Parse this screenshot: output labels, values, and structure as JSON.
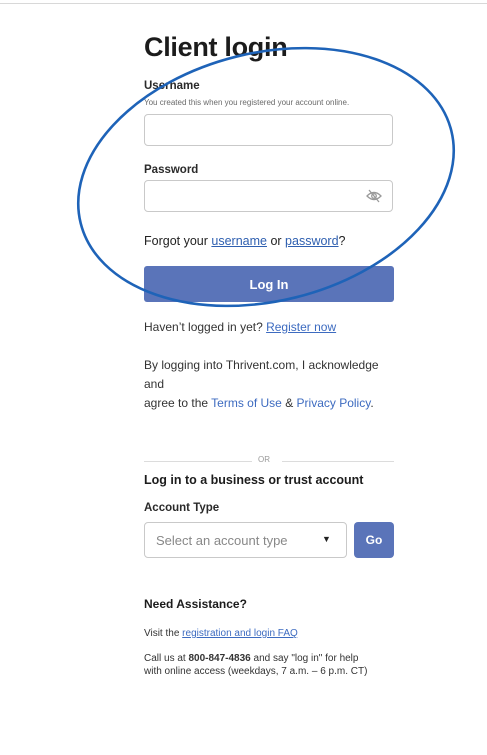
{
  "title": "Client login",
  "username": {
    "label": "Username",
    "hint": "You created this when you registered your account online.",
    "value": ""
  },
  "password": {
    "label": "Password",
    "value": "",
    "icon": "eye-slash-icon"
  },
  "forgot": {
    "prefix": "Forgot your ",
    "username_link": "username",
    "middle": " or ",
    "password_link": "password",
    "suffix": "?"
  },
  "login_button": "Log In",
  "register": {
    "prefix": "Haven’t logged in yet? ",
    "link": "Register now"
  },
  "terms": {
    "line1": "By logging into Thrivent.com, I acknowledge and",
    "line2_prefix": "agree to the ",
    "terms_link": "Terms of Use",
    "amp": " & ",
    "privacy_link": "Privacy Policy",
    "end": "."
  },
  "divider_text": "OR",
  "business": {
    "heading": "Log in to a business or trust account",
    "account_type_label": "Account Type",
    "select_placeholder": "Select an account type",
    "go_button": "Go"
  },
  "assistance": {
    "heading": "Need Assistance?",
    "visit_prefix": "Visit the ",
    "faq_link": "registration and login FAQ",
    "call_prefix": "Call us at ",
    "phone": "800-847-4836",
    "call_suffix": " and say \"log in\" for help",
    "call_line2": "with online access (weekdays, 7 a.m. – 6 p.m. CT)"
  },
  "colors": {
    "button": "#5a74b9",
    "link": "#3d6bc0",
    "annotation": "#1e63b8"
  }
}
